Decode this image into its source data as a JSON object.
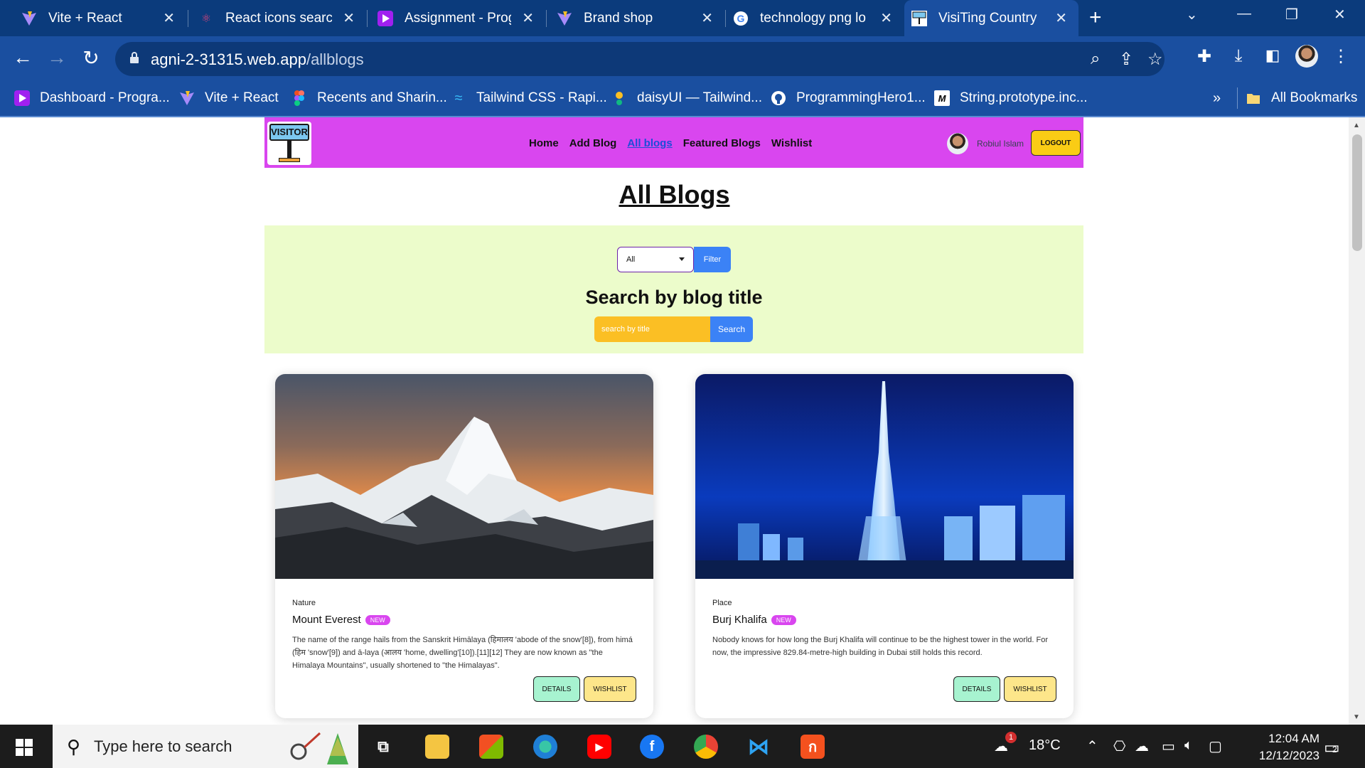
{
  "browser": {
    "tabs": [
      {
        "title": "Vite + React",
        "icon": "vite-icon",
        "active": false
      },
      {
        "title": "React icons search",
        "icon": "react-icon",
        "active": false
      },
      {
        "title": "Assignment - Prog",
        "icon": "programming-hero-icon",
        "active": false
      },
      {
        "title": "Brand shop",
        "icon": "vite-icon",
        "active": false
      },
      {
        "title": "technology png lo",
        "icon": "google-icon",
        "active": false
      },
      {
        "title": "VisiTing Country",
        "icon": "visitor-icon",
        "active": true
      }
    ],
    "url_host": "agni-2-31315.web.app",
    "url_path": "/allblogs",
    "bookmarks": [
      {
        "label": "Dashboard - Progra...",
        "icon": "programming-hero-icon"
      },
      {
        "label": "Vite + React",
        "icon": "vite-icon"
      },
      {
        "label": "Recents and Sharin...",
        "icon": "figma-icon"
      },
      {
        "label": "Tailwind CSS - Rapi...",
        "icon": "tailwind-icon"
      },
      {
        "label": "daisyUI — Tailwind...",
        "icon": "daisyui-icon"
      },
      {
        "label": "ProgrammingHero1...",
        "icon": "github-icon"
      },
      {
        "label": "String.prototype.inc...",
        "icon": "mdn-icon"
      }
    ],
    "bookmarks_overflow": "»",
    "all_bookmarks": "All Bookmarks"
  },
  "site": {
    "logo_text": "VISITOR",
    "nav": [
      {
        "label": "Home",
        "current": false
      },
      {
        "label": "Add Blog",
        "current": false
      },
      {
        "label": "All blogs",
        "current": true
      },
      {
        "label": "Featured Blogs",
        "current": false
      },
      {
        "label": "Wishlist",
        "current": false
      }
    ],
    "user_name": "Robiul Islam",
    "logout_label": "LOGOUT",
    "colors": {
      "nav_bg": "#d946ef",
      "panel_bg": "#ecfccb",
      "primary": "#3b82f6",
      "accent": "#fbbf24"
    }
  },
  "page": {
    "title": "All Blogs",
    "filter": {
      "selected": "All",
      "button": "Filter"
    },
    "search": {
      "heading": "Search by blog title",
      "placeholder": "search by title",
      "button": "Search"
    }
  },
  "blogs": [
    {
      "category": "Nature",
      "title": "Mount Everest",
      "badge": "NEW",
      "description": "The name of the range hails from the Sanskrit Himālaya (हिमालय 'abode of the snow'[8]), from himá (हिम 'snow'[9]) and ā-laya (आलय 'home, dwelling'[10]).[11][12] They are now known as \"the Himalaya Mountains\", usually shortened to \"the Himalayas\".",
      "details_label": "DETAILS",
      "wishlist_label": "WISHLIST"
    },
    {
      "category": "Place",
      "title": "Burj Khalifa",
      "badge": "NEW",
      "description": "Nobody knows for how long the Burj Khalifa will continue to be the highest tower in the world. For now, the impressive 829.84-metre-high building in Dubai still holds this record.",
      "details_label": "DETAILS",
      "wishlist_label": "WISHLIST"
    }
  ],
  "taskbar": {
    "search_placeholder": "Type here to search",
    "weather": "18°C",
    "weather_badge": "1",
    "time": "12:04 AM",
    "date": "12/12/2023",
    "notification_count": "2"
  }
}
